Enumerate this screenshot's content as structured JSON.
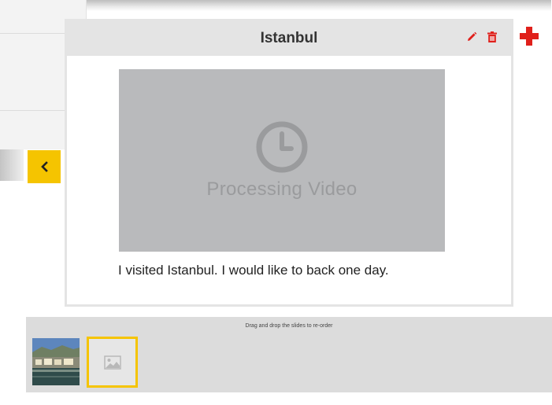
{
  "slide": {
    "title": "Istanbul",
    "video_status": "Processing Video",
    "caption": "I visited Istanbul. I would like to back one day."
  },
  "thumbnails": {
    "hint": "Drag and drop the slides to re-order"
  },
  "colors": {
    "accent_yellow": "#f5c400",
    "action_red": "#e0201b",
    "header_gray": "#e4e4e4",
    "placeholder_gray": "#b9babc"
  },
  "icons": {
    "edit": "pencil-icon",
    "delete": "trash-icon",
    "add": "plus-icon",
    "previous": "chevron-left-icon",
    "processing": "clock-icon",
    "empty_thumb": "image-icon"
  }
}
